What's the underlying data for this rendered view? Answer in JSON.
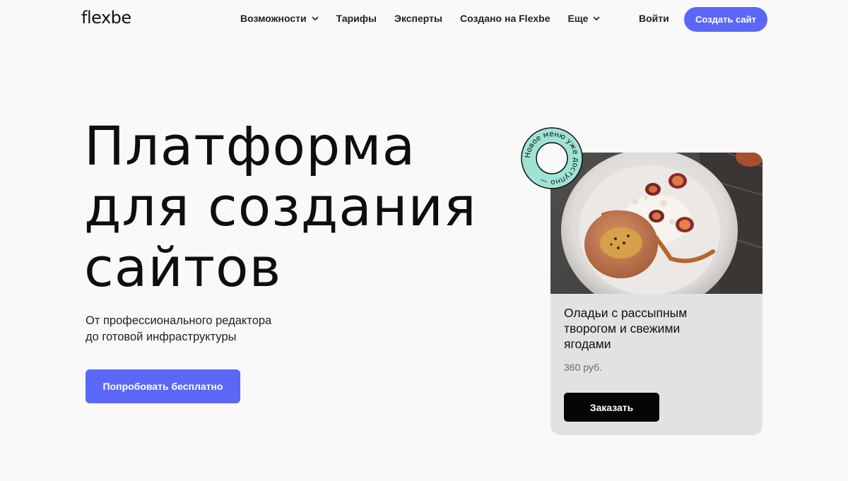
{
  "header": {
    "logo": "flexbe",
    "nav": [
      {
        "label": "Возможности",
        "has_dropdown": true
      },
      {
        "label": "Тарифы",
        "has_dropdown": false
      },
      {
        "label": "Эксперты",
        "has_dropdown": false
      },
      {
        "label": "Создано на Flexbe",
        "has_dropdown": false
      },
      {
        "label": "Еще",
        "has_dropdown": true
      }
    ],
    "login": "Войти",
    "create_site": "Создать сайт"
  },
  "hero": {
    "title_lines": [
      "Платформа",
      "для создания",
      "сайтов"
    ],
    "subtitle_lines": [
      "От профессионального редактора",
      "до готовой инфраструктуры"
    ],
    "cta": "Попробовать бесплатно"
  },
  "card": {
    "badge_text": "Новое меню уже доступно —",
    "title_lines": [
      "Оладьи с рассыпным",
      "творогом и свежими",
      "ягодами"
    ],
    "price": "360 руб.",
    "order_button": "Заказать"
  },
  "colors": {
    "accent": "#5b67f6",
    "background": "#f9f9f9",
    "card_bg": "#e2e2e2",
    "badge": "#9fe3d6"
  }
}
